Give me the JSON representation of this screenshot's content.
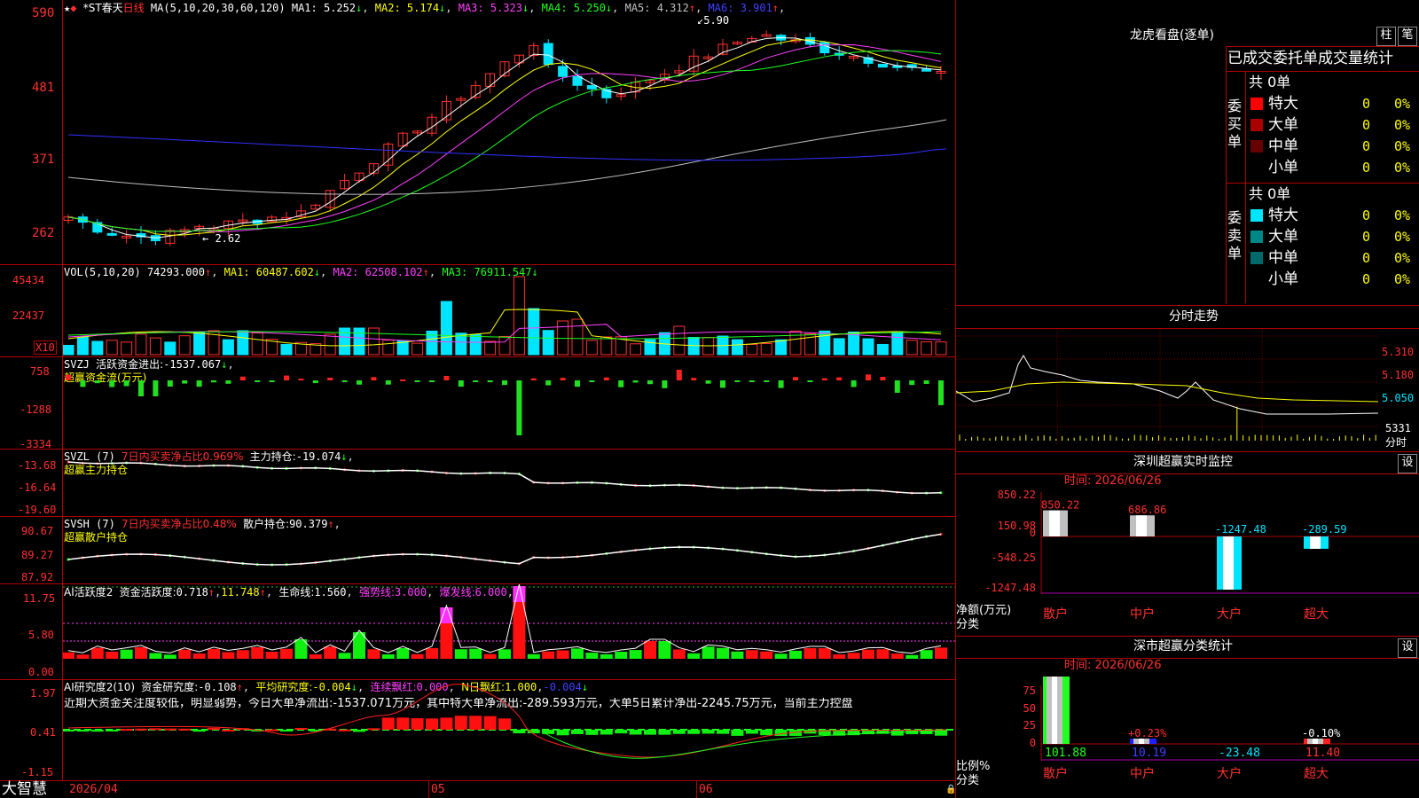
{
  "stock": {
    "star": "★",
    "name": "*ST春天",
    "period": "日线"
  },
  "main_chart": {
    "ma_params": "MA(5,10,20,30,60,120)",
    "ma": [
      {
        "label": "MA1:",
        "value": "5.252",
        "arrow": "↓",
        "color": "#ffffff"
      },
      {
        "label": "MA2:",
        "value": "5.174",
        "arrow": "↓",
        "color": "#ffff00"
      },
      {
        "label": "MA3:",
        "value": "5.323",
        "arrow": "↓",
        "color": "#ff40ff"
      },
      {
        "label": "MA4:",
        "value": "5.250",
        "arrow": "↓",
        "color": "#20ff20"
      },
      {
        "label": "MA5:",
        "value": "4.312",
        "arrow": "↑",
        "color": "#c0c0c0"
      },
      {
        "label": "MA6:",
        "value": "3.901",
        "arrow": "↑",
        "color": "#4040ff"
      }
    ],
    "y_ticks": [
      "590",
      "481",
      "371",
      "262"
    ],
    "high_label": "5.90",
    "low_label": "2.62"
  },
  "vol_panel": {
    "title": "VOL(5,10,20)",
    "value": "74293.000",
    "ma1": "60487.602",
    "ma2": "62508.102",
    "ma3": "76911.547",
    "y_ticks": [
      "45434",
      "22437"
    ],
    "unit": "X10"
  },
  "svzj_panel": {
    "title": "SVZJ",
    "label": "活跃资金进出:",
    "value": "-1537.067",
    "subtitle": "超赢资金流(万元)",
    "y_ticks": [
      "758",
      "-1288",
      "-3334"
    ]
  },
  "svzl_panel": {
    "title": "SVZL (7)",
    "ratio_text": "7日内买卖净占比0.969%",
    "label": "主力持仓:",
    "value": "-19.074",
    "subtitle": "超赢主力持仓",
    "y_ticks": [
      "-13.68",
      "-16.64",
      "-19.60"
    ]
  },
  "svsh_panel": {
    "title": "SVSH (7)",
    "ratio_text": "7日内买卖净占比0.48%",
    "label": "散户持仓:",
    "value": "90.379",
    "subtitle": "超赢散户持仓",
    "y_ticks": [
      "90.67",
      "89.27",
      "87.92"
    ]
  },
  "ai_active_panel": {
    "title": "AI活跃度2",
    "label": "资金活跃度:",
    "value": "0.718",
    "v2": "11.748",
    "life_label": "生命线:",
    "life": "1.560",
    "strong_label": "强势线:",
    "strong": "3.000",
    "burst_label": "爆发线:",
    "burst": "6.000",
    "y_ticks": [
      "11.75",
      "5.80",
      "0.00"
    ]
  },
  "ai_research_panel": {
    "title": "AI研究度2(10)",
    "label": "资金研究度:",
    "value": "-0.108",
    "avg_label": "平均研究度:",
    "avg": "-0.004",
    "red_label": "连续飘红:",
    "red": "0.000",
    "nred_label": "N日飘红:",
    "nred": "1.000",
    "tail": "-0.004",
    "summary": "近期大资金关注度较低，明显弱势，今日大单净流出:-1537.071万元，其中特大单净流出:-289.593万元，大单5日累计净出-2245.75万元，当前主力控盘",
    "y_ticks": [
      "1.97",
      "0.41",
      "-1.15"
    ]
  },
  "x_axis": {
    "labels": [
      "2026/04",
      "05",
      "06"
    ]
  },
  "brand": "大智慧",
  "right": {
    "lhb_title": "龙虎看盘(逐单)",
    "btn_zhu": "柱",
    "btn_bi": "笔",
    "tabs_header": "已成交委托单成交量统计",
    "buy": {
      "side": "委买单",
      "total": "共 0单",
      "rows": [
        {
          "name": "特大",
          "val": "0",
          "pct": "0%",
          "color": "#ff0000"
        },
        {
          "name": "大单",
          "val": "0",
          "pct": "0%",
          "color": "#aa0000"
        },
        {
          "name": "中单",
          "val": "0",
          "pct": "0%",
          "color": "#660000"
        },
        {
          "name": "小单",
          "val": "0",
          "pct": "0%",
          "color": ""
        }
      ]
    },
    "sell": {
      "side": "委卖单",
      "total": "共 0单",
      "rows": [
        {
          "name": "特大",
          "val": "0",
          "pct": "0%",
          "color": "#00e5ff"
        },
        {
          "name": "大单",
          "val": "0",
          "pct": "0%",
          "color": "#008888"
        },
        {
          "name": "中单",
          "val": "0",
          "pct": "0%",
          "color": "#006a6a"
        },
        {
          "name": "小单",
          "val": "0",
          "pct": "0%",
          "color": ""
        }
      ]
    },
    "intraday": {
      "title": "分时走势",
      "ticks": [
        "5.310",
        "5.180",
        "5.050"
      ],
      "vol": "5331",
      "vol_label": "分时"
    },
    "monitor": {
      "title": "深圳超赢实时监控",
      "btn": "设",
      "time_label": "时间:",
      "time": "2026/06/26",
      "y_ticks": [
        "850.22",
        "150.98",
        "0",
        "-548.25",
        "-1247.48"
      ],
      "axis_label": "净额(万元)",
      "cat_label": "分类",
      "categories": [
        "散户",
        "中户",
        "大户",
        "超大"
      ],
      "values_text": [
        "850.22",
        "686.86",
        "-1247.48",
        "-289.59"
      ]
    },
    "classify": {
      "title": "深市超赢分类统计",
      "btn": "设",
      "time_label": "时间:",
      "time": "2026/06/26",
      "y_ticks": [
        "75",
        "50",
        "25",
        "0"
      ],
      "axis_label": "比例%",
      "cat_label": "分类",
      "categories": [
        "散户",
        "中户",
        "大户",
        "超大"
      ],
      "bottom_values": [
        "101.88",
        "10.19",
        "-23.48",
        "11.40"
      ],
      "top_values": [
        "",
        "+0.23%",
        "",
        "-0.10%"
      ]
    }
  }
}
